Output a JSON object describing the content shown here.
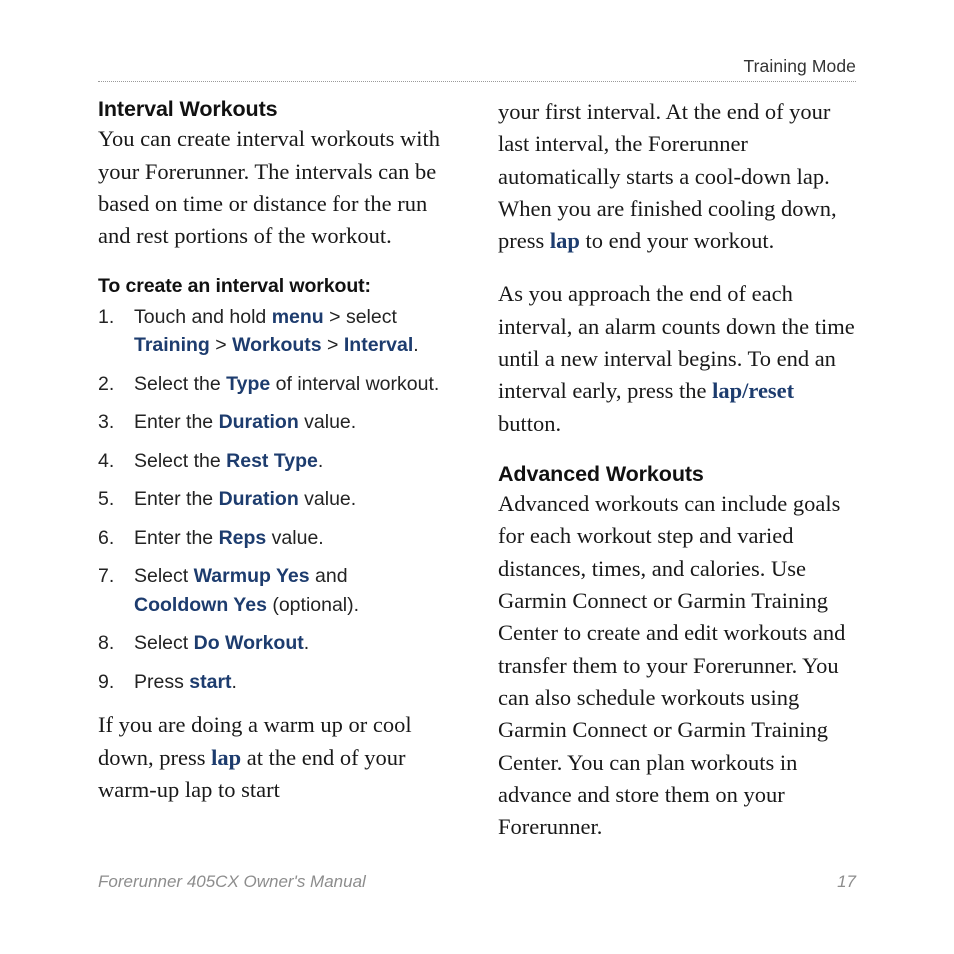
{
  "header": {
    "running_head": "Training Mode"
  },
  "left_column": {
    "heading": "Interval Workouts",
    "intro_paragraph": "You can create interval workouts with your Forerunner. The intervals can be based on time or distance for the run and rest portions of the workout.",
    "procedure_heading": "To create an interval workout:",
    "steps": [
      {
        "number": "1.",
        "parts": [
          {
            "text": "Touch and hold ",
            "style": "plain"
          },
          {
            "text": "menu",
            "style": "ui"
          },
          {
            "text": " > select ",
            "style": "plain"
          },
          {
            "text": "Training",
            "style": "ui"
          },
          {
            "text": " > ",
            "style": "plain"
          },
          {
            "text": "Workouts",
            "style": "ui"
          },
          {
            "text": " > ",
            "style": "plain"
          },
          {
            "text": "Interval",
            "style": "ui"
          },
          {
            "text": ".",
            "style": "plain"
          }
        ]
      },
      {
        "number": "2.",
        "parts": [
          {
            "text": "Select the ",
            "style": "plain"
          },
          {
            "text": "Type",
            "style": "ui"
          },
          {
            "text": " of interval workout.",
            "style": "plain"
          }
        ]
      },
      {
        "number": "3.",
        "parts": [
          {
            "text": "Enter the ",
            "style": "plain"
          },
          {
            "text": "Duration",
            "style": "ui"
          },
          {
            "text": " value.",
            "style": "plain"
          }
        ]
      },
      {
        "number": "4.",
        "parts": [
          {
            "text": "Select the ",
            "style": "plain"
          },
          {
            "text": "Rest Type",
            "style": "ui"
          },
          {
            "text": ".",
            "style": "plain"
          }
        ]
      },
      {
        "number": "5.",
        "parts": [
          {
            "text": "Enter the ",
            "style": "plain"
          },
          {
            "text": "Duration",
            "style": "ui"
          },
          {
            "text": " value.",
            "style": "plain"
          }
        ]
      },
      {
        "number": "6.",
        "parts": [
          {
            "text": "Enter the ",
            "style": "plain"
          },
          {
            "text": "Reps",
            "style": "ui"
          },
          {
            "text": " value.",
            "style": "plain"
          }
        ]
      },
      {
        "number": "7.",
        "parts": [
          {
            "text": "Select ",
            "style": "plain"
          },
          {
            "text": "Warmup Yes",
            "style": "ui"
          },
          {
            "text": " and ",
            "style": "plain"
          },
          {
            "text": "Cooldown Yes",
            "style": "ui"
          },
          {
            "text": " (optional).",
            "style": "plain"
          }
        ]
      },
      {
        "number": "8.",
        "parts": [
          {
            "text": "Select ",
            "style": "plain"
          },
          {
            "text": "Do Workout",
            "style": "ui"
          },
          {
            "text": ".",
            "style": "plain"
          }
        ]
      },
      {
        "number": "9.",
        "parts": [
          {
            "text": "Press ",
            "style": "plain"
          },
          {
            "text": "start",
            "style": "ui"
          },
          {
            "text": ".",
            "style": "plain"
          }
        ]
      }
    ],
    "closing_paragraph": {
      "parts": [
        {
          "text": "If you are doing a warm up or cool down, press ",
          "style": "plain"
        },
        {
          "text": "lap",
          "style": "ui"
        },
        {
          "text": " at the end of your warm-up lap to start",
          "style": "plain"
        }
      ]
    }
  },
  "right_column": {
    "continued_paragraph": {
      "parts": [
        {
          "text": "your first interval. At the end of your last interval, the Forerunner automatically starts a cool-down lap. When you are finished cooling down, press ",
          "style": "plain"
        },
        {
          "text": "lap",
          "style": "ui"
        },
        {
          "text": " to end your workout.",
          "style": "plain"
        }
      ]
    },
    "alarm_paragraph": {
      "parts": [
        {
          "text": "As you approach the end of each interval, an alarm counts down the time until a new interval begins. To end an interval early, press the ",
          "style": "plain"
        },
        {
          "text": "lap/reset",
          "style": "ui"
        },
        {
          "text": " button.",
          "style": "plain"
        }
      ]
    },
    "heading": "Advanced Workouts",
    "advanced_paragraph": "Advanced workouts can include goals for each workout step and varied distances, times, and calories. Use Garmin Connect or Garmin Training Center to create and edit workouts and transfer them to your Forerunner. You can also schedule workouts using Garmin Connect or Garmin Training Center. You can plan workouts in advance and store them on your Forerunner."
  },
  "footer": {
    "manual_title": "Forerunner 405CX Owner's Manual",
    "page_number": "17"
  },
  "colors": {
    "ui_term_navy": "#1d3c6e",
    "body_text": "#181818",
    "header_gray": "#333333",
    "footer_gray": "#8d8d8d",
    "rule_gray": "#9a9a9a"
  }
}
